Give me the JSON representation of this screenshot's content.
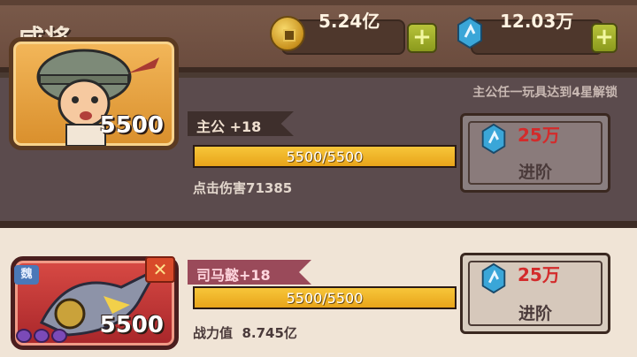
{
  "header": {
    "title": "咸将",
    "coins": "5.24亿",
    "gems": "12.03万"
  },
  "colors": {
    "accent": "#f7c63a",
    "cost_red": "#d32b2b"
  },
  "unlock_hint": "主公任一玩具达到4星解锁",
  "units": [
    {
      "name": "主公 +18",
      "power": "5500",
      "bar_text": "5500/5500",
      "progress_fraction": 1.0,
      "stat_label": "点击伤害",
      "stat_value": "71385",
      "cost": "25万",
      "upgrade_label": "进阶",
      "icon": "soldier-portrait"
    },
    {
      "name": "司马懿+18",
      "power": "5500",
      "bar_text": "5500/5500",
      "progress_fraction": 1.0,
      "stat_label": "战力值",
      "stat_value": "8.745亿",
      "cost": "25万",
      "upgrade_label": "进阶",
      "kingdom": "魏",
      "class_icon": "crossed-swords-icon",
      "icon": "mecha-portrait"
    }
  ]
}
